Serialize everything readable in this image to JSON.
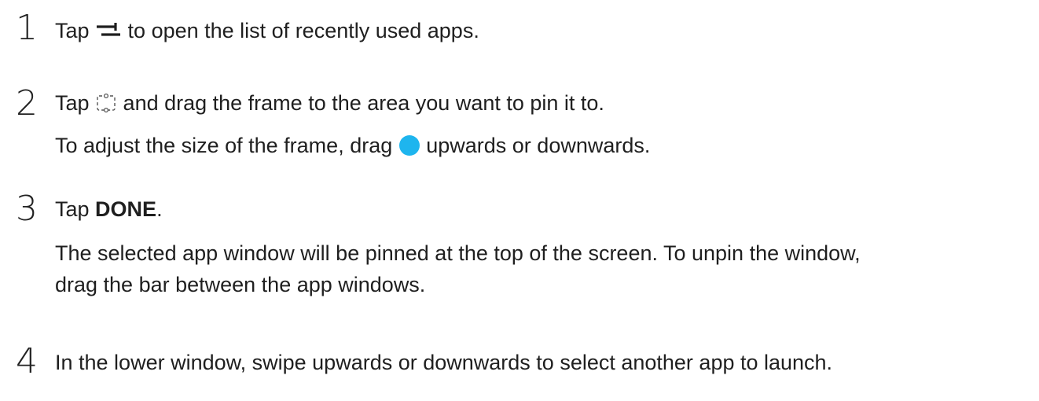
{
  "steps": [
    {
      "number": "1",
      "before_icon": "Tap ",
      "icon": "recent-apps-icon",
      "after_icon": " to open the list of recently used apps."
    },
    {
      "number": "2",
      "before_icon": "Tap ",
      "icon": "pin-window-icon",
      "after_icon": " and drag the frame to the area you want to pin it to.",
      "note_before": "To adjust the size of the frame, drag ",
      "note_icon": "blue-handle-icon",
      "note_after": " upwards or downwards."
    },
    {
      "number": "3",
      "text_before": "Tap ",
      "bold_text": "DONE",
      "text_after": ".",
      "para_line1": "The selected app window will be pinned at the top of the screen. To unpin the window,",
      "para_line2": "drag the bar between the app windows."
    },
    {
      "number": "4",
      "text": "In the lower window, swipe upwards or downwards to select another app to launch."
    }
  ],
  "colors": {
    "text": "#1f1f1f",
    "handle": "#1eb5ee"
  }
}
